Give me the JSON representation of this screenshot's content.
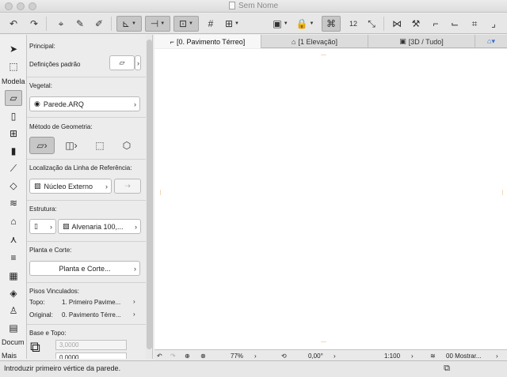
{
  "window": {
    "title": "Sem Nome"
  },
  "toolbar": {
    "icons": [
      "undo-icon",
      "redo-icon",
      "pet-palette-icon",
      "eyedropper-icon",
      "syringe-icon",
      "guide-line-icon",
      "snap-icon",
      "coordinate-icon",
      "grid-icon",
      "suspend-groups-icon",
      "layer-icon",
      "lock-icon",
      "magic-wand-icon",
      "measure-icon",
      "story-icon",
      "trim-icon",
      "hammer-icon",
      "corner-icon",
      "split-icon",
      "adjust-icon"
    ],
    "story_number": "12"
  },
  "toolbox": {
    "label_model": "Modela",
    "label_docs": "Docum",
    "label_more": "Mais",
    "tools": [
      "arrow-tool-icon",
      "marquee-tool-icon",
      "wall-tool-icon",
      "door-tool-icon",
      "window-tool-icon",
      "column-tool-icon",
      "beam-tool-icon",
      "slab-tool-icon",
      "stair-tool-icon",
      "roof-tool-icon",
      "shell-tool-icon",
      "mesh-tool-icon",
      "curtain-wall-tool-icon",
      "morph-tool-icon",
      "object-tool-icon",
      "zone-tool-icon"
    ]
  },
  "infobox": {
    "principal_label": "Principal:",
    "definicoes_label": "Definições padrão",
    "vegetal_label": "Vegetal:",
    "vegetal_value": "Parede.ARQ",
    "metodo_label": "Método de Geometria:",
    "localizacao_label": "Localização da Linha de Referência:",
    "localizacao_value": "Núcleo Externo",
    "estrutura_label": "Estrutura:",
    "estrutura_value": "Alvenaria 100,...",
    "planta_label": "Planta e Corte:",
    "planta_value": "Planta e Corte...",
    "pisos_label": "Pisos Vinculados:",
    "topo_label": "Topo:",
    "topo_value": "1. Primeiro Pavime...",
    "original_label": "Original:",
    "original_value": "0. Pavimento Térre...",
    "base_topo_label": "Base e Topo:",
    "height_top": "3,0000",
    "height_base": "0,0000"
  },
  "tabs": [
    {
      "label": "[0. Pavimento Térreo]",
      "icon": "floor-plan-icon",
      "active": true
    },
    {
      "label": "[1 Elevação]",
      "icon": "elevation-icon",
      "active": false
    },
    {
      "label": "[3D / Tudo]",
      "icon": "3d-icon",
      "active": false
    }
  ],
  "bottombar": {
    "zoom": "77%",
    "angle": "0,00°",
    "scale": "1:100",
    "layer_combo": "00 Mostrar..."
  },
  "status": {
    "message": "Introduzir primeiro vértice da parede."
  },
  "colors": {
    "canvas": "#ffffff",
    "marker": "#e8a35a",
    "panel": "#ececec"
  }
}
